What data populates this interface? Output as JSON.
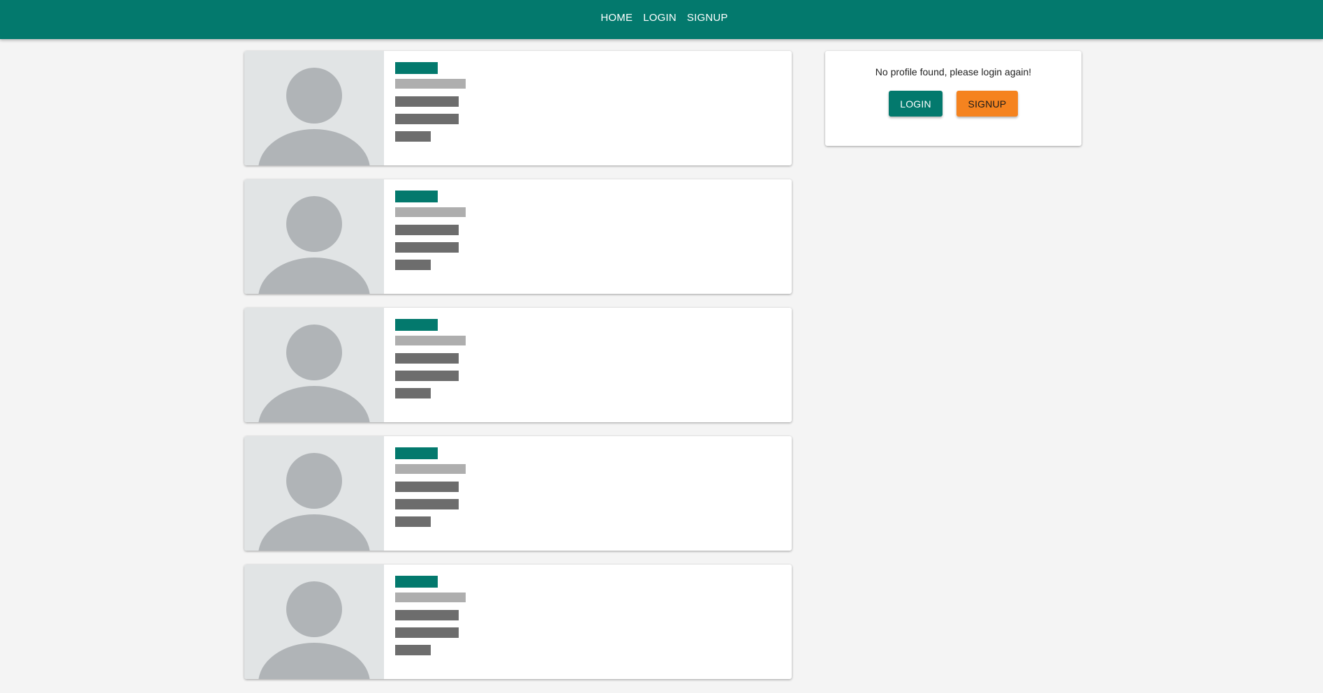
{
  "nav": {
    "links": [
      "HOME",
      "LOGIN",
      "SIGNUP"
    ]
  },
  "profile_panel": {
    "message": "No profile found, please login again!",
    "login_label": "LOGIN",
    "signup_label": "SIGNUP"
  },
  "colors": {
    "primary": "#03796d",
    "accent": "#f5831f",
    "placeholder_light": "#aeaeae",
    "placeholder_dark": "#6d6d6d",
    "avatar_bg": "#e1e4e5",
    "avatar_fg": "#b0b4b7"
  },
  "feed": {
    "card_count": 5
  }
}
